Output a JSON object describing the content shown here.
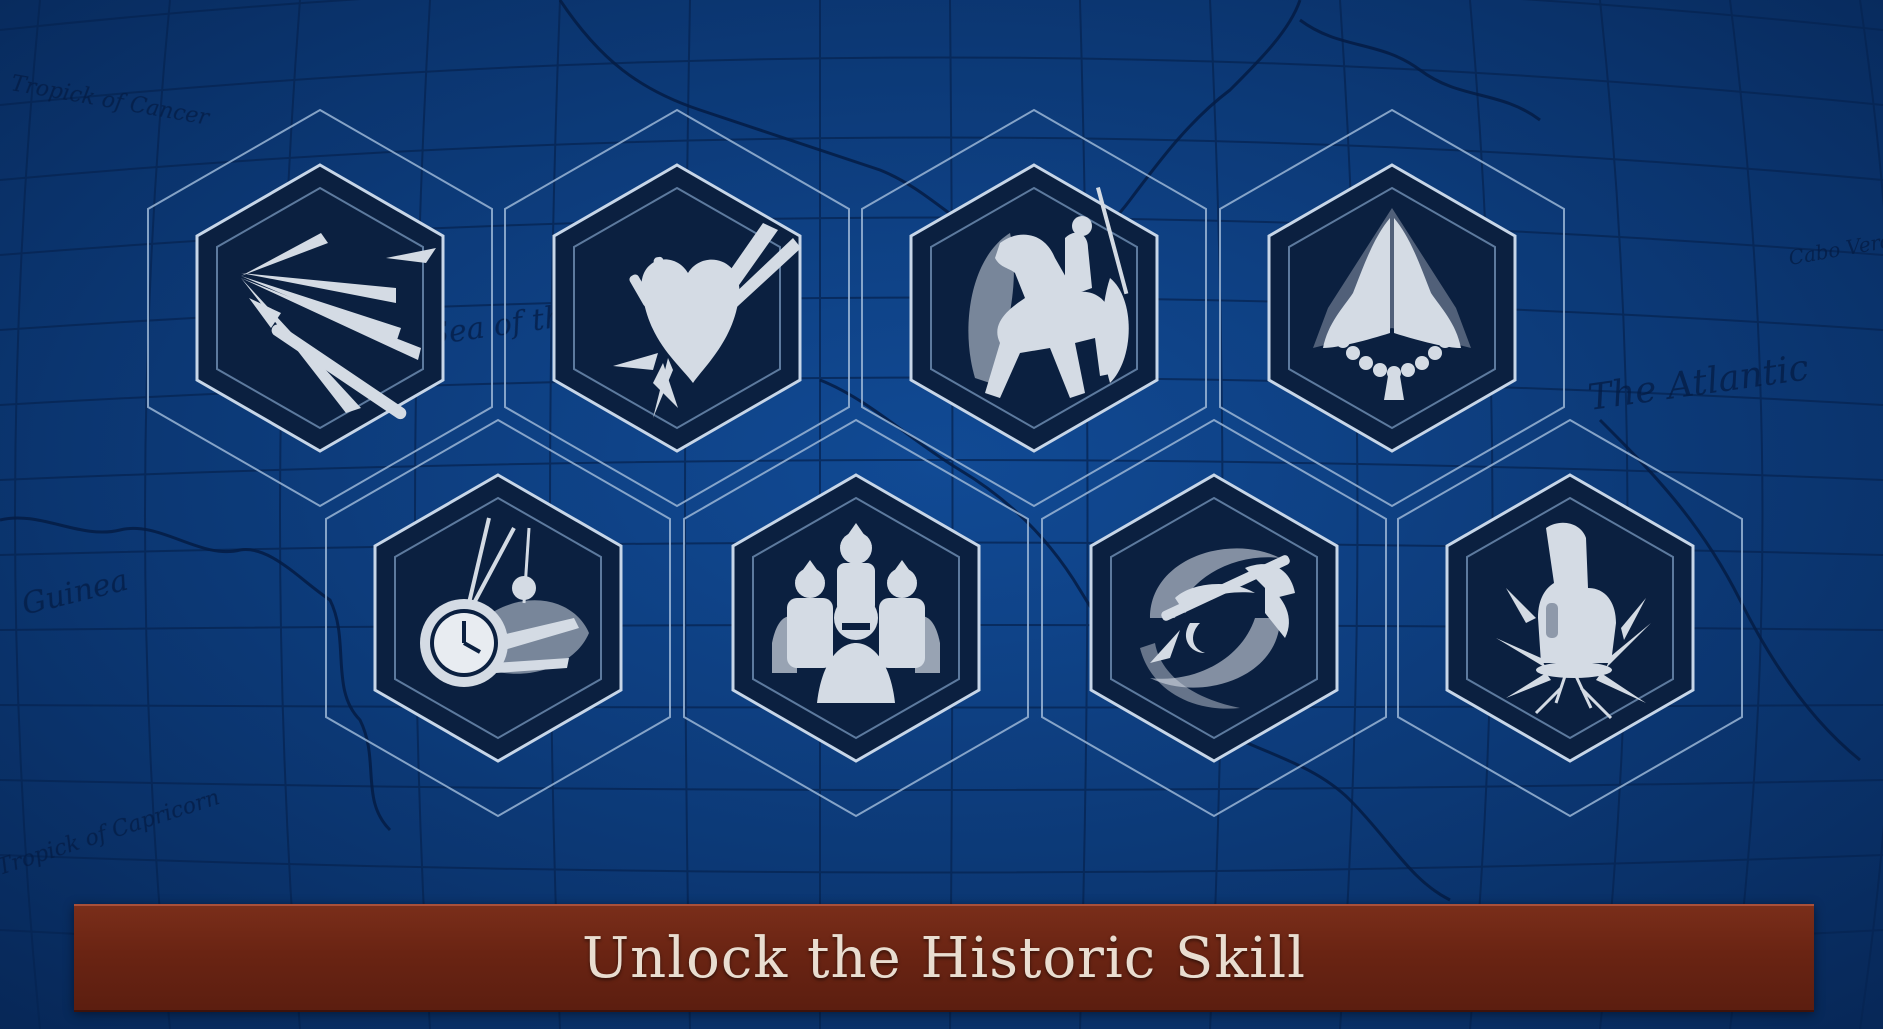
{
  "colors": {
    "ocean": "#0c3f86",
    "map_lines": "#062452",
    "hex_outline": "#9bb6d6",
    "hex_fill": "#0b2040",
    "icon": "#d4dbe4",
    "banner": "#6a2413",
    "banner_text": "#e9ddd0"
  },
  "map_labels": [
    {
      "text": "Tropick of Cancer"
    },
    {
      "text": "Sea of the Sul"
    },
    {
      "text": "The Atlantic"
    },
    {
      "text": "Guinea"
    },
    {
      "text": "Tropick of Capricorn"
    },
    {
      "text": "Cabo Verde"
    }
  ],
  "skills": [
    {
      "icon": "spear-thrust-icon"
    },
    {
      "icon": "pierced-heart-icon"
    },
    {
      "icon": "mounted-knight-icon"
    },
    {
      "icon": "praying-hands-icon"
    },
    {
      "icon": "pocket-watch-icon"
    },
    {
      "icon": "soldier-group-icon"
    },
    {
      "icon": "whirling-axe-icon"
    },
    {
      "icon": "ground-fist-icon"
    }
  ],
  "banner": {
    "title": "Unlock the Historic Skill"
  }
}
